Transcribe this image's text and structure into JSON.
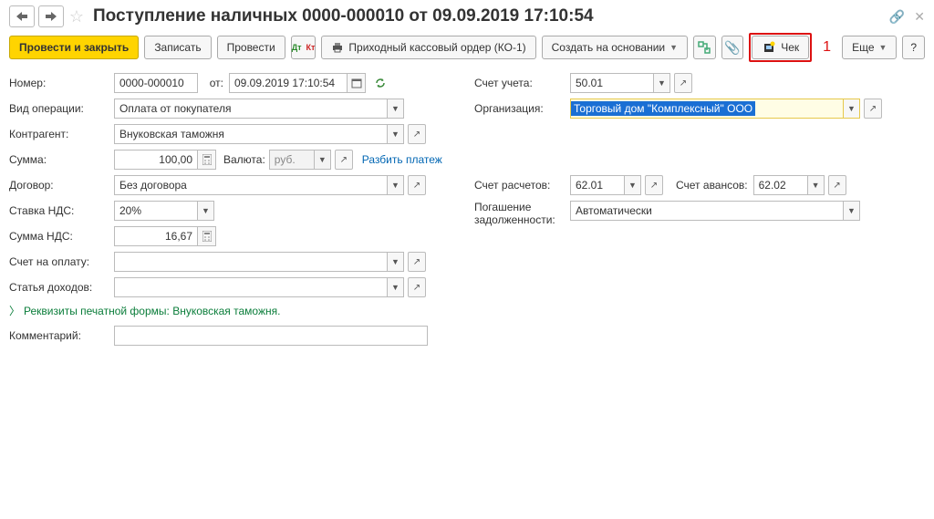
{
  "title": "Поступление наличных 0000-000010 от 09.09.2019 17:10:54",
  "toolbar": {
    "postAndClose": "Провести и закрыть",
    "save": "Записать",
    "post": "Провести",
    "printKO1": "Приходный кассовый ордер (КО-1)",
    "createBasedOn": "Создать на основании",
    "check": "Чек",
    "more": "Еще"
  },
  "annot": "1",
  "labels": {
    "number": "Номер:",
    "from": "от:",
    "opType": "Вид операции:",
    "counterparty": "Контрагент:",
    "sum": "Сумма:",
    "currency": "Валюта:",
    "splitPayment": "Разбить платеж",
    "contract": "Договор:",
    "vatRate": "Ставка НДС:",
    "vatSum": "Сумма НДС:",
    "invoice": "Счет на оплату:",
    "incomeItem": "Статья доходов:",
    "printFormReq": "Реквизиты печатной формы: Внуковская таможня.",
    "comment": "Комментарий:",
    "account": "Счет учета:",
    "organization": "Организация:",
    "settleAccount": "Счет расчетов:",
    "advanceAccount": "Счет авансов:",
    "debtClosing": "Погашение задолженности:"
  },
  "values": {
    "number": "0000-000010",
    "date": "09.09.2019 17:10:54",
    "opType": "Оплата от покупателя",
    "counterparty": "Внуковская таможня",
    "sum": "100,00",
    "currency": "руб.",
    "contract": "Без договора",
    "vatRate": "20%",
    "vatSum": "16,67",
    "invoice": "",
    "incomeItem": "",
    "comment": "",
    "account": "50.01",
    "organization": "Торговый дом \"Комплексный\" ООО",
    "settleAccount": "62.01",
    "advanceAccount": "62.02",
    "debtClosing": "Автоматически"
  }
}
